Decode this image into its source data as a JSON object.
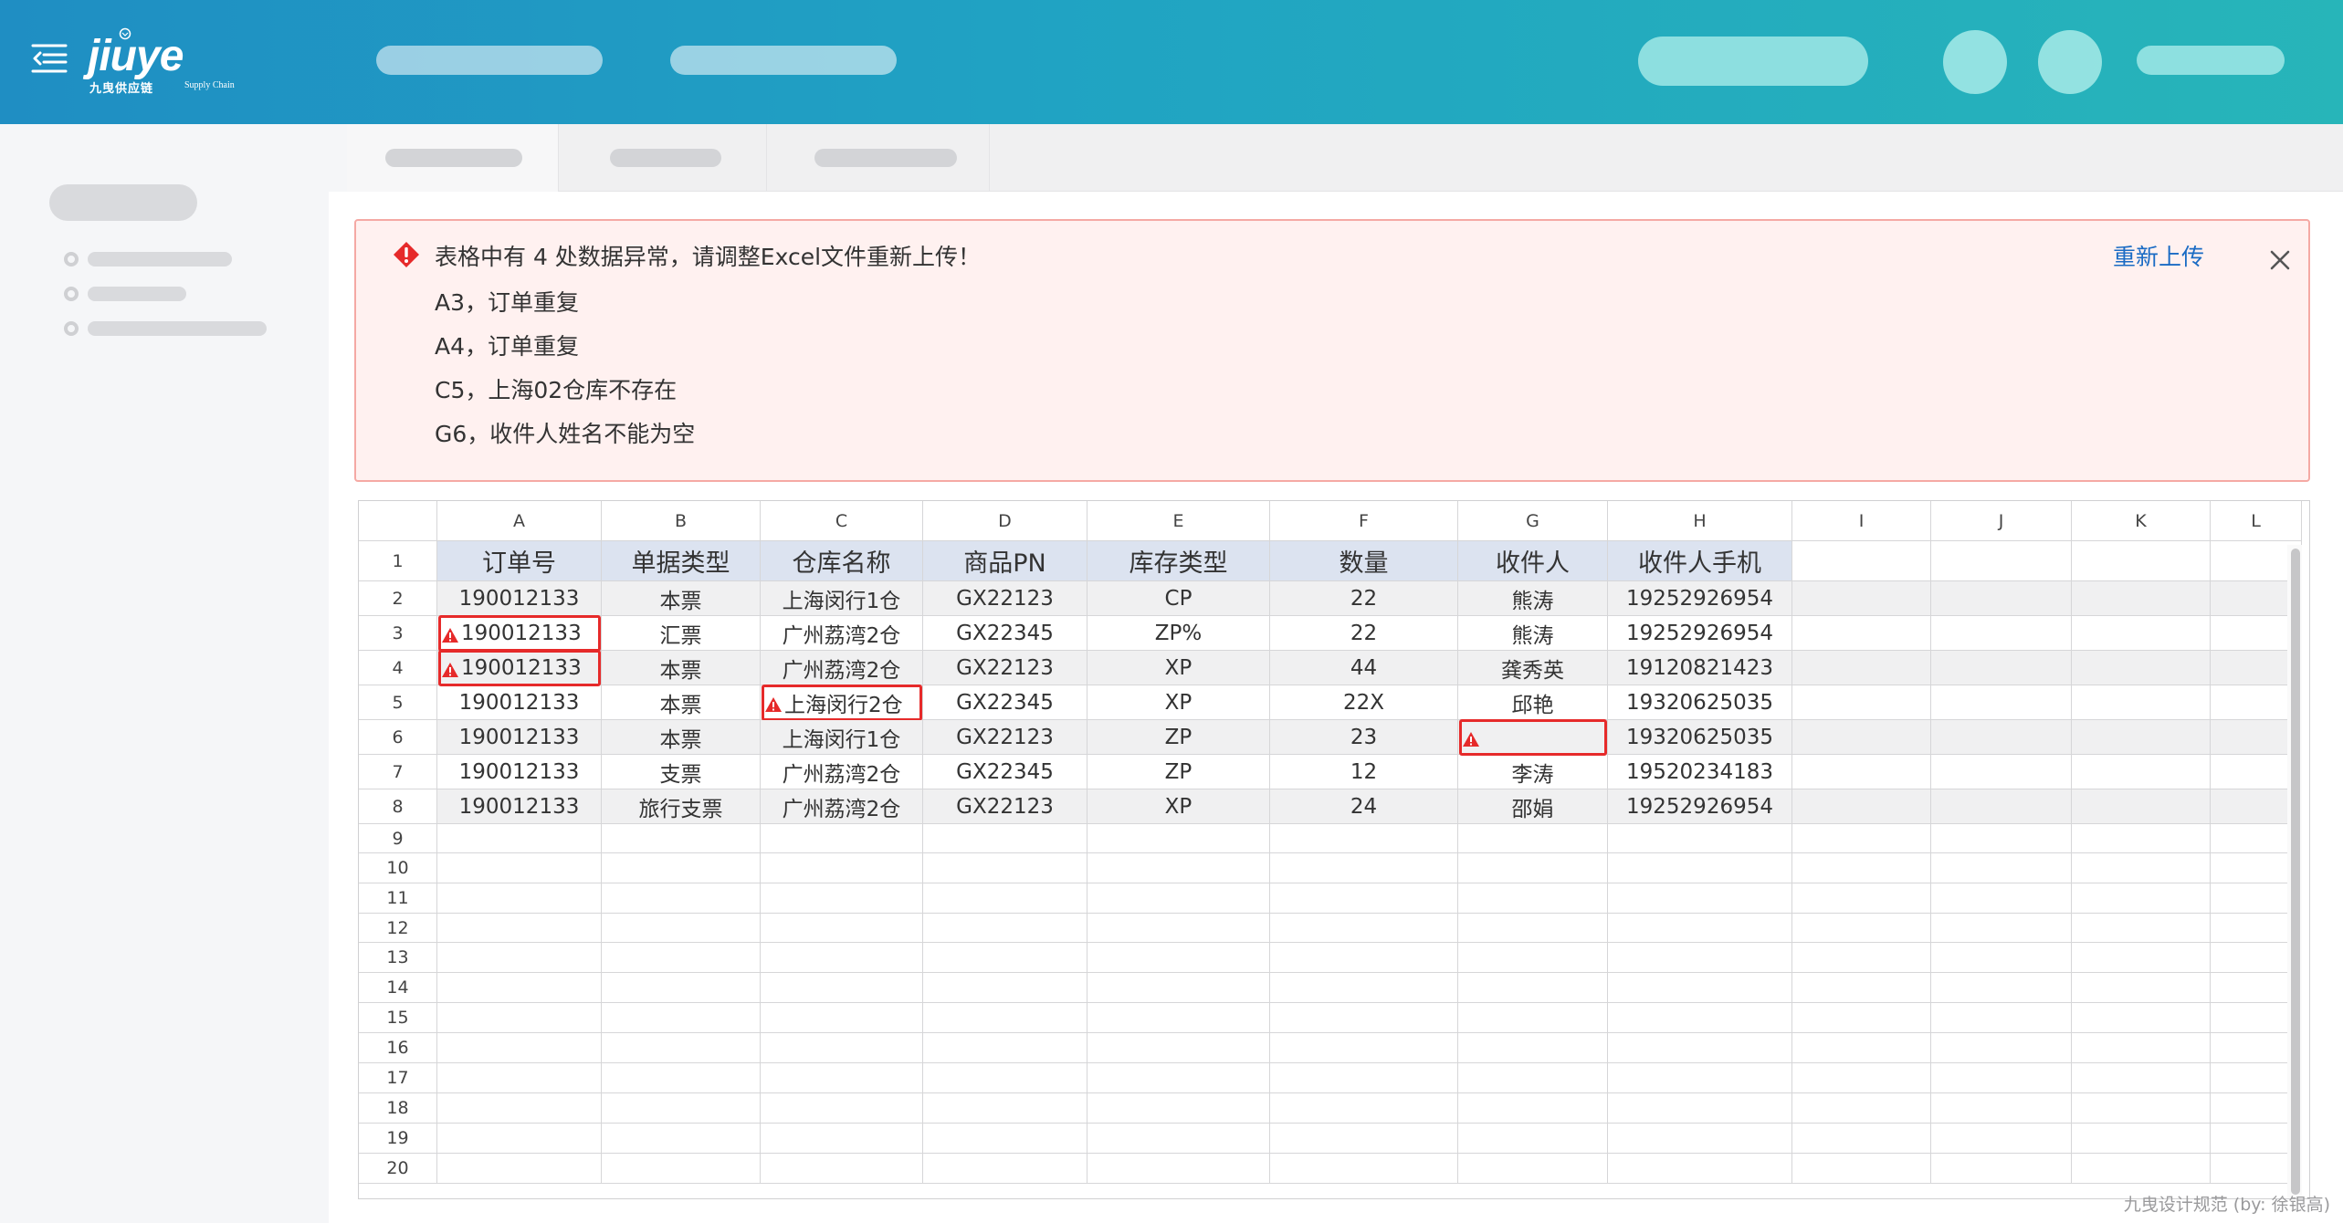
{
  "brand": {
    "wordmark": "jiuye",
    "cn_name": "九曳供应链",
    "en_name": "Supply Chain"
  },
  "alert": {
    "title": "表格中有 4 处数据异常，请调整Excel文件重新上传！",
    "items": [
      "A3，订单重复",
      "A4，订单重复",
      "C5，上海02仓库不存在",
      "G6，收件人姓名不能为空"
    ],
    "action_label": "重新上传",
    "color": "#e62a2a"
  },
  "sheet": {
    "columns": [
      "A",
      "B",
      "C",
      "D",
      "E",
      "F",
      "G",
      "H",
      "I",
      "J",
      "K",
      "L"
    ],
    "rows": [
      "1",
      "2",
      "3",
      "4",
      "5",
      "6",
      "7",
      "8",
      "9",
      "10",
      "11",
      "12",
      "13",
      "14",
      "15",
      "16",
      "17",
      "18",
      "19",
      "20"
    ],
    "header": [
      "订单号",
      "单据类型",
      "仓库名称",
      "商品PN",
      "库存类型",
      "数量",
      "收件人",
      "收件人手机"
    ],
    "data": [
      [
        "190012133",
        "本票",
        "上海闵行1仓",
        "GX22123",
        "CP",
        "22",
        "熊涛",
        "19252926954"
      ],
      [
        "190012133",
        "汇票",
        "广州荔湾2仓",
        "GX22345",
        "ZP%",
        "22",
        "熊涛",
        "19252926954"
      ],
      [
        "190012133",
        "本票",
        "广州荔湾2仓",
        "GX22123",
        "XP",
        "44",
        "龚秀英",
        "19120821423"
      ],
      [
        "190012133",
        "本票",
        "上海闵行2仓",
        "GX22345",
        "XP",
        "22X",
        "邱艳",
        "19320625035"
      ],
      [
        "190012133",
        "本票",
        "上海闵行1仓",
        "GX22123",
        "ZP",
        "23",
        "",
        "19320625035"
      ],
      [
        "190012133",
        "支票",
        "广州荔湾2仓",
        "GX22345",
        "ZP",
        "12",
        "李涛",
        "19520234183"
      ],
      [
        "190012133",
        "旅行支票",
        "广州荔湾2仓",
        "GX22123",
        "XP",
        "24",
        "邵娟",
        "19252926954"
      ]
    ],
    "errors": [
      {
        "cell": "A3",
        "row": 3,
        "col": 0
      },
      {
        "cell": "A4",
        "row": 4,
        "col": 0
      },
      {
        "cell": "C5",
        "row": 5,
        "col": 2
      },
      {
        "cell": "G6",
        "row": 6,
        "col": 6
      }
    ]
  },
  "watermark": "九曳设计规范 (by: 徐银高)"
}
